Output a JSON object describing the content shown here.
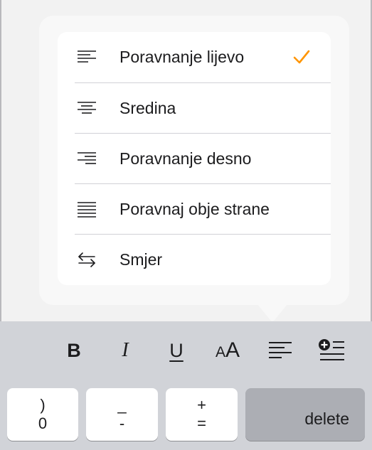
{
  "menu": {
    "items": [
      {
        "label": "Poravnanje lijevo",
        "icon": "align-left-icon",
        "checked": true
      },
      {
        "label": "Sredina",
        "icon": "align-center-icon",
        "checked": false
      },
      {
        "label": "Poravnanje desno",
        "icon": "align-right-icon",
        "checked": false
      },
      {
        "label": "Poravnaj obje strane",
        "icon": "align-justify-icon",
        "checked": false
      },
      {
        "label": "Smjer",
        "icon": "text-direction-icon",
        "checked": false
      }
    ],
    "check_color": "#ff9500"
  },
  "toolbar": {
    "bold_label": "B",
    "italic_label": "I",
    "underline_label": "U",
    "font_size_small": "A",
    "font_size_large": "A",
    "tools": [
      "bold-button",
      "italic-button",
      "underline-button",
      "font-size-button",
      "alignment-button",
      "insert-button"
    ]
  },
  "keyboard": {
    "keys": [
      {
        "top": ")",
        "bottom": "0"
      },
      {
        "top": "_",
        "bottom": "-"
      },
      {
        "top": "+",
        "bottom": "="
      }
    ],
    "delete_label": "delete"
  }
}
